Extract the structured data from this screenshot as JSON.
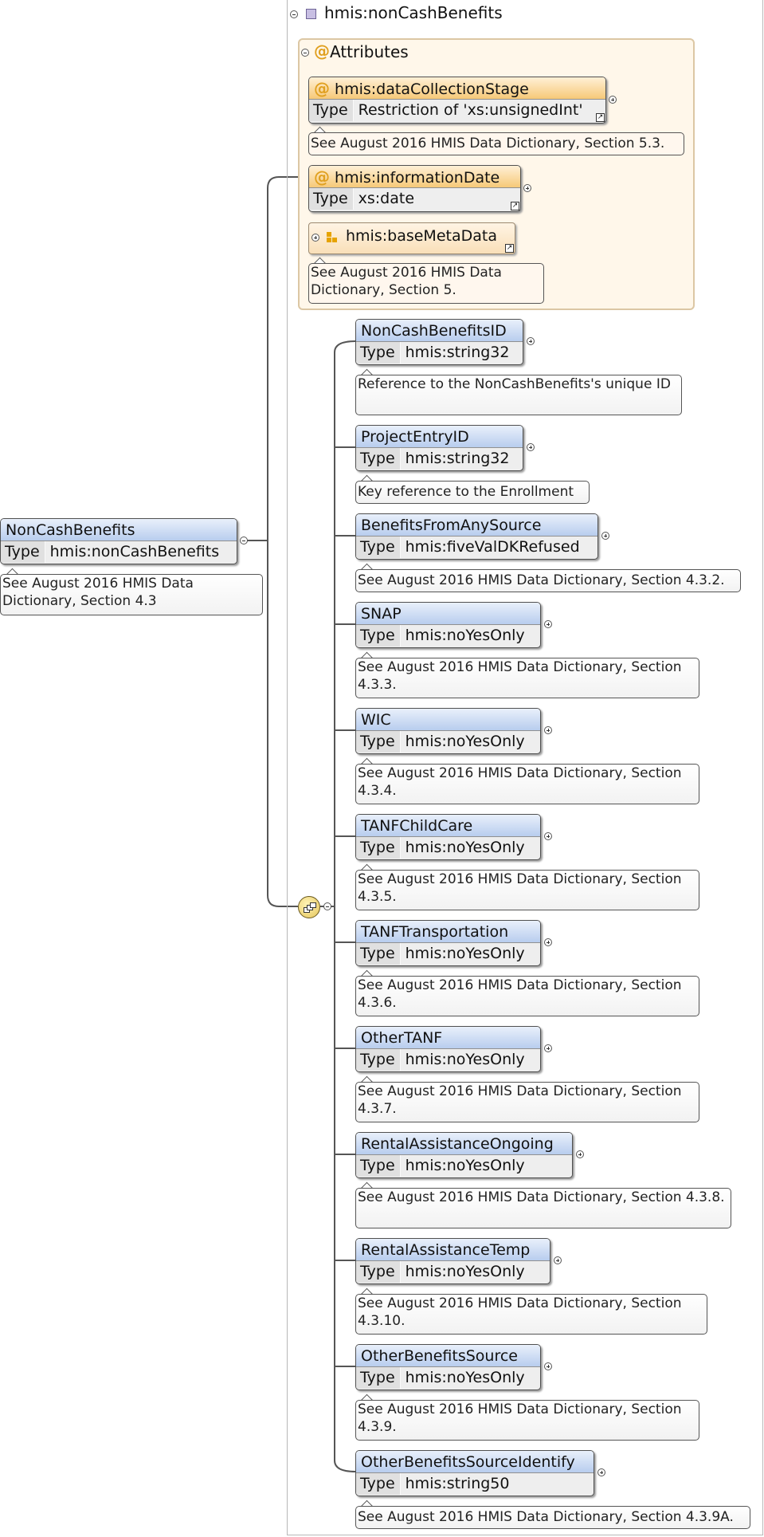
{
  "root": {
    "title": "hmis:nonCashBenefits"
  },
  "attributes": {
    "heading": "Attributes",
    "at_symbol": "@",
    "items": [
      {
        "name": "hmis:dataCollectionStage",
        "type_label": "Type",
        "type": "Restriction of 'xs:unsignedInt'",
        "doc": "See August 2016 HMIS Data Dictionary, Section 5.3."
      },
      {
        "name": "hmis:informationDate",
        "type_label": "Type",
        "type": "xs:date"
      }
    ],
    "base_group": {
      "name": "hmis:baseMetaData",
      "doc": "See August 2016 HMIS Data Dictionary, Section 5."
    }
  },
  "main_element": {
    "name": "NonCashBenefits",
    "type_label": "Type",
    "type": "hmis:nonCashBenefits",
    "doc": "See August 2016 HMIS Data Dictionary, Section 4.3"
  },
  "elements": [
    {
      "name": "NonCashBenefitsID",
      "type_label": "Type",
      "type": "hmis:string32",
      "doc": "Reference to the NonCashBenefits's unique ID"
    },
    {
      "name": "ProjectEntryID",
      "type_label": "Type",
      "type": "hmis:string32",
      "doc": "Key reference to the Enrollment"
    },
    {
      "name": "BenefitsFromAnySource",
      "type_label": "Type",
      "type": "hmis:fiveValDKRefused",
      "doc": "See August 2016 HMIS Data Dictionary, Section 4.3.2."
    },
    {
      "name": "SNAP",
      "type_label": "Type",
      "type": "hmis:noYesOnly",
      "doc": "See August 2016 HMIS Data Dictionary, Section 4.3.3."
    },
    {
      "name": "WIC",
      "type_label": "Type",
      "type": "hmis:noYesOnly",
      "doc": "See August 2016 HMIS Data Dictionary, Section 4.3.4."
    },
    {
      "name": "TANFChildCare",
      "type_label": "Type",
      "type": "hmis:noYesOnly",
      "doc": "See August 2016 HMIS Data Dictionary, Section 4.3.5."
    },
    {
      "name": "TANFTransportation",
      "type_label": "Type",
      "type": "hmis:noYesOnly",
      "doc": "See August 2016 HMIS Data Dictionary, Section 4.3.6."
    },
    {
      "name": "OtherTANF",
      "type_label": "Type",
      "type": "hmis:noYesOnly",
      "doc": "See August 2016 HMIS Data Dictionary, Section 4.3.7."
    },
    {
      "name": "RentalAssistanceOngoing",
      "type_label": "Type",
      "type": "hmis:noYesOnly",
      "doc": "See August 2016 HMIS Data Dictionary, Section 4.3.8."
    },
    {
      "name": "RentalAssistanceTemp",
      "type_label": "Type",
      "type": "hmis:noYesOnly",
      "doc": "See August 2016 HMIS Data Dictionary, Section 4.3.10."
    },
    {
      "name": "OtherBenefitsSource",
      "type_label": "Type",
      "type": "hmis:noYesOnly",
      "doc": "See August 2016 HMIS Data Dictionary, Section 4.3.9."
    },
    {
      "name": "OtherBenefitsSourceIdentify",
      "type_label": "Type",
      "type": "hmis:string50",
      "doc": "See August 2016 HMIS Data Dictionary, Section 4.3.9A."
    }
  ]
}
